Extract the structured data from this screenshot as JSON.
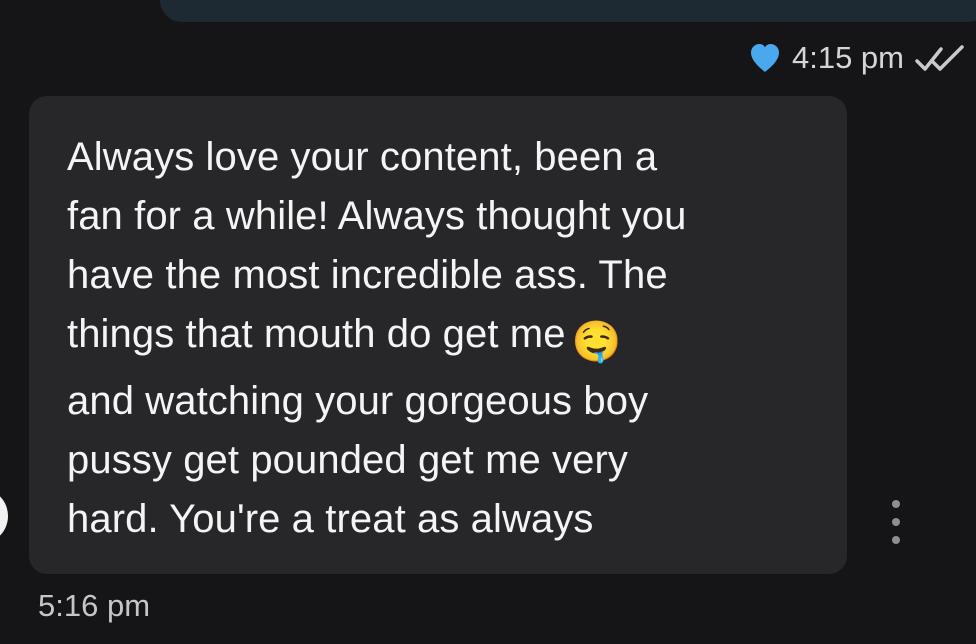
{
  "sent_message": {
    "time": "4:15 pm",
    "reaction_icon": "heart-icon",
    "reaction_color": "#4aa8ec",
    "status_icon": "double-check-icon"
  },
  "received_message": {
    "lines": [
      "Always love your content, been a",
      "fan for a while! Always thought you",
      "have the most incredible ass. The",
      "things that mouth do get me",
      "and watching your gorgeous boy",
      "pussy get pounded get me very",
      "hard. You're a treat as always"
    ],
    "emoji": "🤤",
    "time": "5:16 pm"
  },
  "actions": {
    "more_icon": "vertical-dots-icon"
  }
}
